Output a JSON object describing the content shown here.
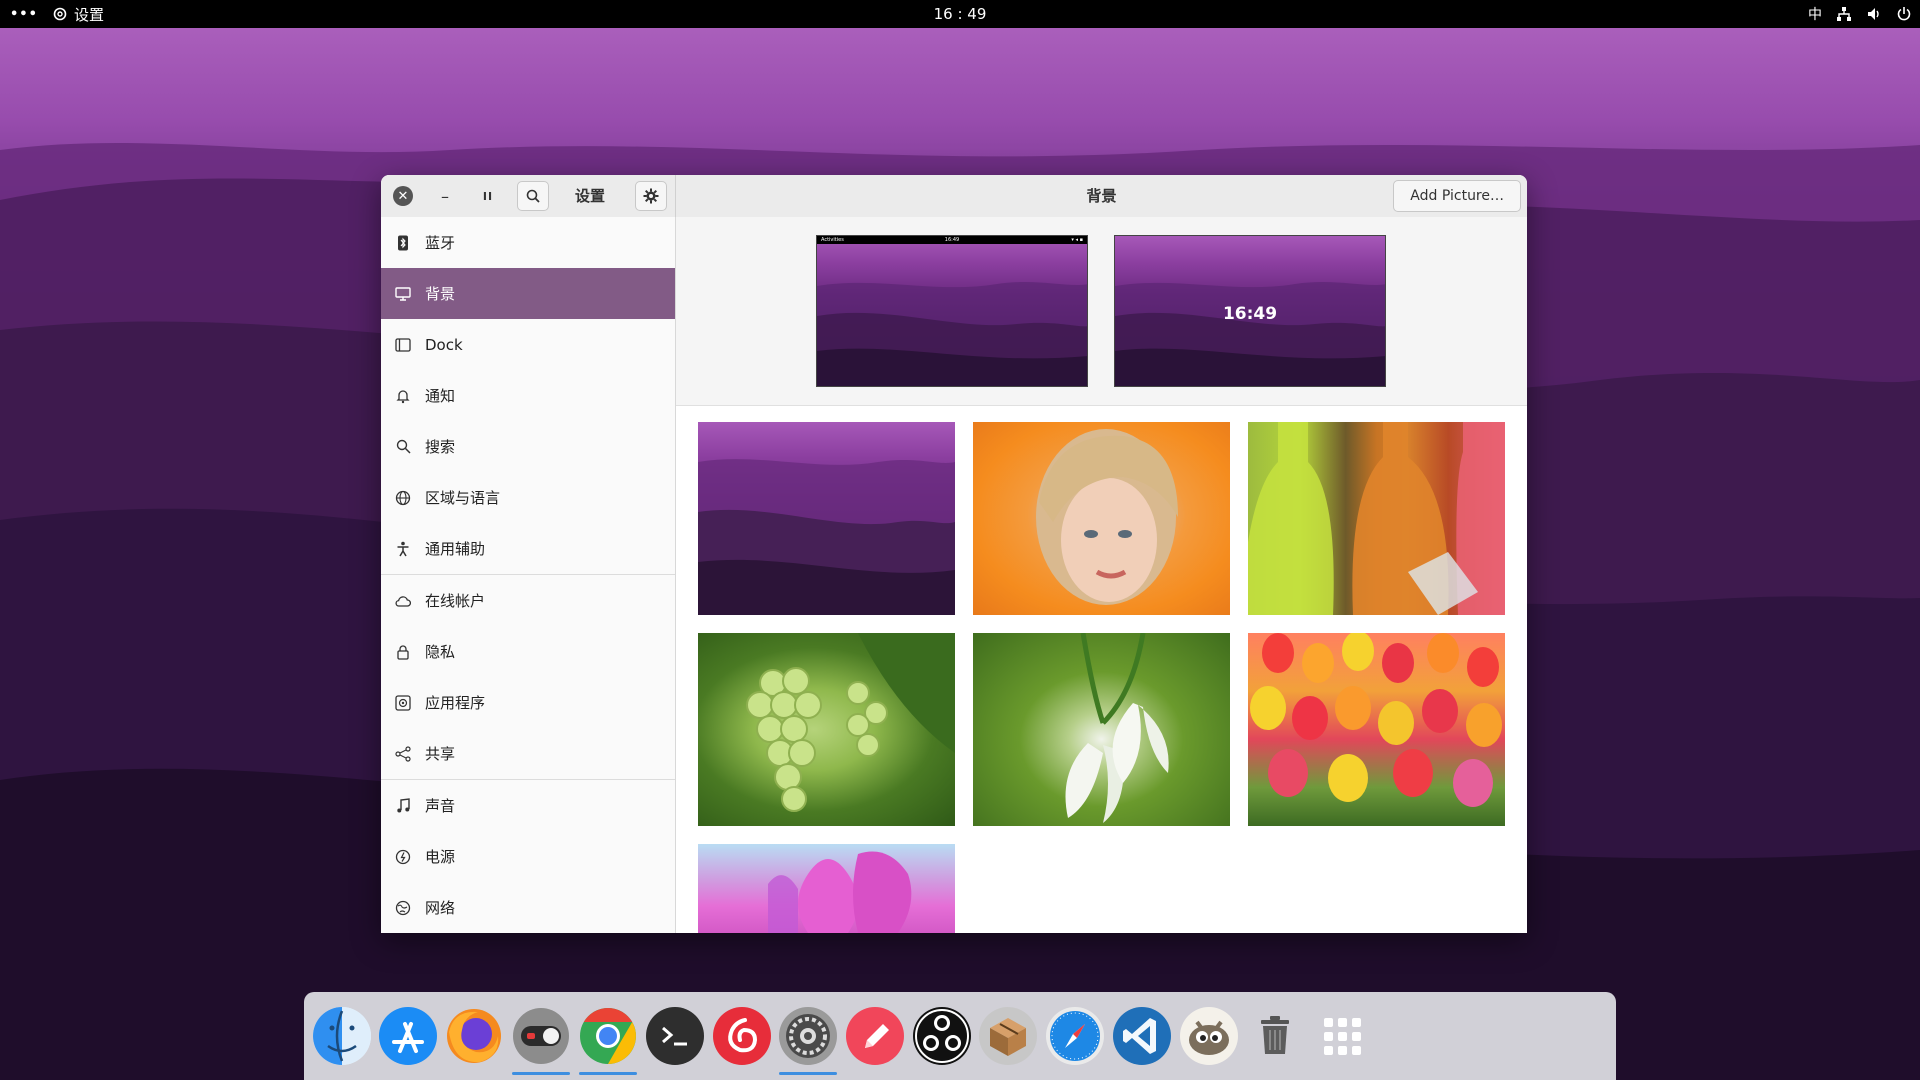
{
  "topbar": {
    "activities": "•••",
    "app_name": "设置",
    "clock": "16 : 49",
    "input_method": "中"
  },
  "window": {
    "sidebar_title": "设置",
    "page_title": "背景",
    "add_picture_label": "Add Picture…"
  },
  "sidebar": {
    "items": [
      {
        "label": "蓝牙",
        "icon": "bluetooth-icon"
      },
      {
        "label": "背景",
        "icon": "display-icon"
      },
      {
        "label": "Dock",
        "icon": "dock-icon"
      },
      {
        "label": "通知",
        "icon": "bell-icon"
      },
      {
        "label": "搜索",
        "icon": "search-icon"
      },
      {
        "label": "区域与语言",
        "icon": "globe-icon"
      },
      {
        "label": "通用辅助",
        "icon": "accessibility-icon"
      },
      {
        "label": "在线帐户",
        "icon": "cloud-icon"
      },
      {
        "label": "隐私",
        "icon": "lock-icon"
      },
      {
        "label": "应用程序",
        "icon": "apps-icon"
      },
      {
        "label": "共享",
        "icon": "share-icon"
      },
      {
        "label": "声音",
        "icon": "music-icon"
      },
      {
        "label": "电源",
        "icon": "power-icon"
      },
      {
        "label": "网络",
        "icon": "network-icon"
      }
    ],
    "active_index": 1
  },
  "previews": {
    "desktop_bar_left": "Activities",
    "desktop_bar_clock": "16:49",
    "lock_clock": "16:49"
  },
  "wallpapers": [
    {
      "name": "purple-mountains"
    },
    {
      "name": "portrait-orange"
    },
    {
      "name": "bottles"
    },
    {
      "name": "grapes"
    },
    {
      "name": "snowdrops"
    },
    {
      "name": "tulips"
    },
    {
      "name": "pink-tulips"
    }
  ],
  "dock": {
    "apps": [
      {
        "name": "finder-icon",
        "color": "#2c8ef0"
      },
      {
        "name": "app-store-icon",
        "color": "#1b8cf5"
      },
      {
        "name": "firefox-icon",
        "color": "#f07c1c"
      },
      {
        "name": "toggle-app-icon",
        "color": "#6b6b6b"
      },
      {
        "name": "chrome-icon",
        "color": "#e94235"
      },
      {
        "name": "terminal-icon",
        "color": "#2e2e2e"
      },
      {
        "name": "netease-music-icon",
        "color": "#e72d3a"
      },
      {
        "name": "system-settings-icon",
        "color": "#555555"
      },
      {
        "name": "pencil-app-icon",
        "color": "#f1465a"
      },
      {
        "name": "obs-icon",
        "color": "#111111"
      },
      {
        "name": "package-icon",
        "color": "#9c6b3a"
      },
      {
        "name": "safari-icon",
        "color": "#1e88e5"
      },
      {
        "name": "vscode-icon",
        "color": "#1f6fb8"
      },
      {
        "name": "gimp-icon",
        "color": "#e8e2d6"
      },
      {
        "name": "trash-icon",
        "color": "#555555"
      },
      {
        "name": "app-grid-icon",
        "color": "#ffffff"
      }
    ]
  }
}
